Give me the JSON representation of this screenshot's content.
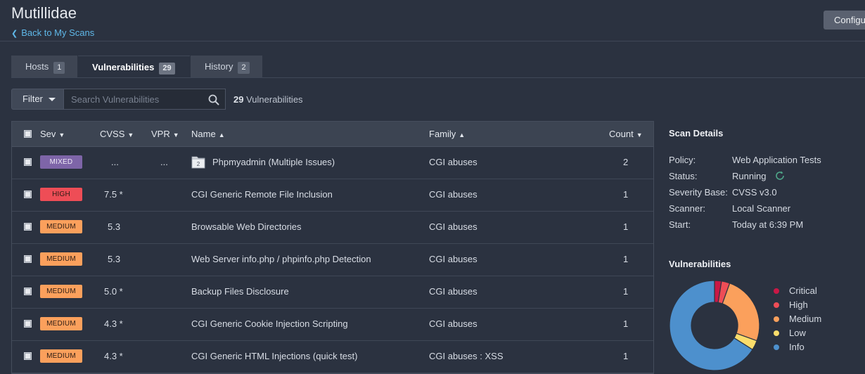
{
  "header": {
    "title": "Mutillidae",
    "back_link": "Back to My Scans",
    "configure_label": "Configure"
  },
  "tabs": [
    {
      "label": "Hosts",
      "count": "1"
    },
    {
      "label": "Vulnerabilities",
      "count": "29"
    },
    {
      "label": "History",
      "count": "2"
    }
  ],
  "toolbar": {
    "filter_label": "Filter",
    "search_placeholder": "Search Vulnerabilities",
    "result_count": "29",
    "result_suffix": "Vulnerabilities"
  },
  "table": {
    "columns": {
      "sev": "Sev",
      "cvss": "CVSS",
      "vpr": "VPR",
      "name": "Name",
      "family": "Family",
      "count": "Count"
    },
    "rows": [
      {
        "sev": "MIXED",
        "sev_color": "#7e65a8",
        "cvss": "...",
        "vpr": "...",
        "name": "Phpmyadmin (Multiple Issues)",
        "group_count": "2",
        "family": "CGI abuses",
        "count": "2"
      },
      {
        "sev": "HIGH",
        "sev_color": "#ee4d56",
        "cvss": "7.5 *",
        "vpr": "",
        "name": "CGI Generic Remote File Inclusion",
        "family": "CGI abuses",
        "count": "1"
      },
      {
        "sev": "MEDIUM",
        "sev_color": "#fba05c",
        "cvss": "5.3",
        "vpr": "",
        "name": "Browsable Web Directories",
        "family": "CGI abuses",
        "count": "1"
      },
      {
        "sev": "MEDIUM",
        "sev_color": "#fba05c",
        "cvss": "5.3",
        "vpr": "",
        "name": "Web Server info.php / phpinfo.php Detection",
        "family": "CGI abuses",
        "count": "1"
      },
      {
        "sev": "MEDIUM",
        "sev_color": "#fba05c",
        "cvss": "5.0 *",
        "vpr": "",
        "name": "Backup Files Disclosure",
        "family": "CGI abuses",
        "count": "1"
      },
      {
        "sev": "MEDIUM",
        "sev_color": "#fba05c",
        "cvss": "4.3 *",
        "vpr": "",
        "name": "CGI Generic Cookie Injection Scripting",
        "family": "CGI abuses",
        "count": "1"
      },
      {
        "sev": "MEDIUM",
        "sev_color": "#fba05c",
        "cvss": "4.3 *",
        "vpr": "",
        "name": "CGI Generic HTML Injections (quick test)",
        "family": "CGI abuses : XSS",
        "count": "1"
      }
    ]
  },
  "scan_details": {
    "title": "Scan Details",
    "items": [
      {
        "label": "Policy:",
        "value": "Web Application Tests"
      },
      {
        "label": "Status:",
        "value": "Running"
      },
      {
        "label": "Severity Base:",
        "value": "CVSS v3.0"
      },
      {
        "label": "Scanner:",
        "value": "Local Scanner"
      },
      {
        "label": "Start:",
        "value": "Today at 6:39 PM"
      }
    ]
  },
  "vulnerabilities_chart": {
    "title": "Vulnerabilities",
    "legend": [
      {
        "label": "Critical",
        "color": "#c91846"
      },
      {
        "label": "High",
        "color": "#ee4d56"
      },
      {
        "label": "Medium",
        "color": "#fba05c"
      },
      {
        "label": "Low",
        "color": "#fbdd6b"
      },
      {
        "label": "Info",
        "color": "#4d90cd"
      }
    ]
  },
  "chart_data": {
    "type": "pie",
    "title": "Vulnerabilities",
    "donut": true,
    "categories": [
      "Critical",
      "High",
      "Medium",
      "Low",
      "Info"
    ],
    "values": [
      2.5,
      3,
      25,
      3.5,
      66
    ],
    "colors": [
      "#c91846",
      "#ee4d56",
      "#fba05c",
      "#fbdd6b",
      "#4d90cd"
    ],
    "legend_position": "right"
  }
}
